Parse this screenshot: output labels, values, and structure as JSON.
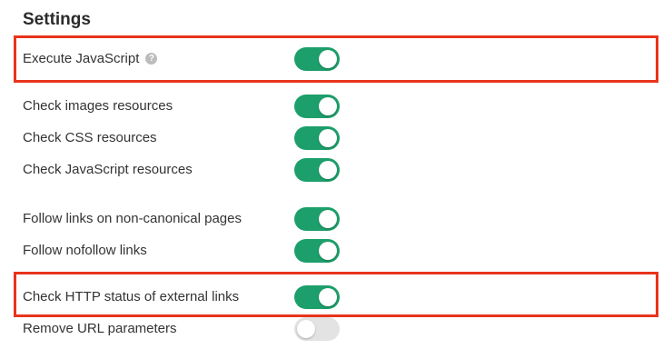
{
  "settings": {
    "title": "Settings",
    "items": [
      {
        "label": "Execute JavaScript",
        "has_help": true,
        "help_icon": "question-circle-icon",
        "enabled": true,
        "highlighted": true
      },
      {
        "label": "Check images resources",
        "enabled": true
      },
      {
        "label": "Check CSS resources",
        "enabled": true
      },
      {
        "label": "Check JavaScript resources",
        "enabled": true
      },
      {
        "label": "Follow links on non-canonical pages",
        "enabled": true
      },
      {
        "label": "Follow nofollow links",
        "enabled": true
      },
      {
        "label": "Check HTTP status of external links",
        "enabled": true,
        "highlighted": true
      },
      {
        "label": "Remove URL parameters",
        "enabled": false
      }
    ],
    "help_glyph": "?"
  },
  "colors": {
    "toggle_on": "#1d9f6b",
    "toggle_off": "#e3e3e3",
    "highlight_border": "#e8341c"
  }
}
